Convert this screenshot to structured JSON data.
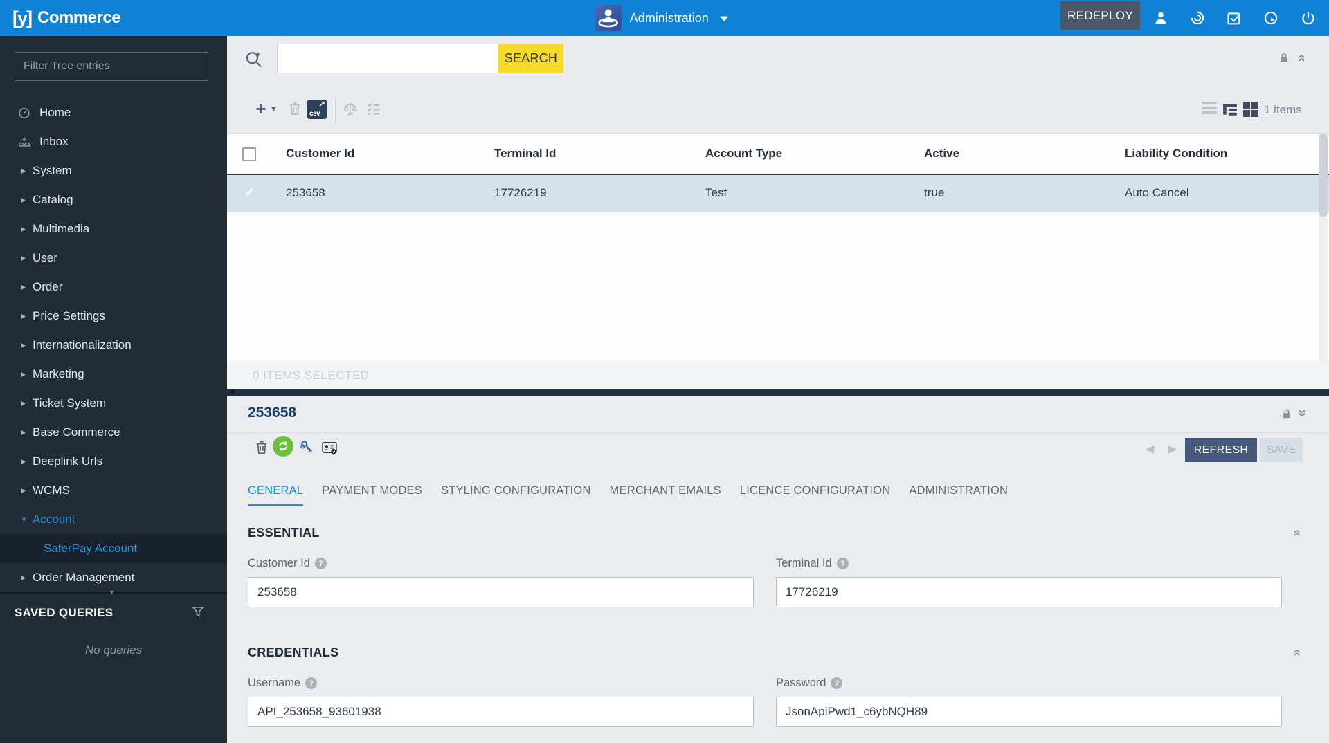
{
  "glyphs": {
    "expand": "▶",
    "collapse": "▼",
    "check": "✓",
    "prev": "◀",
    "next": "▶",
    "chevron_double": "»",
    "plus": "+",
    "caret": "▼",
    "question": "?",
    "arrow_up_right": "↗",
    "csv": "csv",
    "splitter_handle": "◀"
  },
  "colors": {
    "topbar_blue": "#1082d6",
    "accent_blue": "#1793e0",
    "search_yellow": "#f6da2a",
    "sidebar_bg": "#222c37",
    "selected_row_blue": "#d4e2ee",
    "splitter_navy": "#233140",
    "refresh_button": "#44597b"
  },
  "topbar": {
    "logo_mark": "[y]",
    "logo_text": "Commerce",
    "perspective_label": "Administration",
    "redeploy_label": "REDEPLOY"
  },
  "sidebar": {
    "filter_placeholder": "Filter Tree entries",
    "items": [
      {
        "label": "Home"
      },
      {
        "label": "Inbox"
      },
      {
        "label": "System"
      },
      {
        "label": "Catalog"
      },
      {
        "label": "Multimedia"
      },
      {
        "label": "User"
      },
      {
        "label": "Order"
      },
      {
        "label": "Price Settings"
      },
      {
        "label": "Internationalization"
      },
      {
        "label": "Marketing"
      },
      {
        "label": "Ticket System"
      },
      {
        "label": "Base Commerce"
      },
      {
        "label": "Deeplink Urls"
      },
      {
        "label": "WCMS"
      },
      {
        "label": "Account"
      },
      {
        "label": "SaferPay Account"
      },
      {
        "label": "Order Management"
      }
    ],
    "saved_queries_title": "SAVED QUERIES",
    "no_queries_text": "No queries"
  },
  "search": {
    "input_value": "",
    "button_label": "SEARCH"
  },
  "collection": {
    "items_count": "1 items",
    "columns": [
      "Customer Id",
      "Terminal Id",
      "Account Type",
      "Active",
      "Liability Condition"
    ],
    "row": [
      "253658",
      "17726219",
      "Test",
      "true",
      "Auto Cancel"
    ],
    "selected_bar_text": "0 ITEMS SELECTED"
  },
  "editor": {
    "title": "253658",
    "refresh_label": "REFRESH",
    "save_label": "SAVE",
    "tabs": [
      "GENERAL",
      "PAYMENT MODES",
      "STYLING CONFIGURATION",
      "MERCHANT EMAILS",
      "LICENCE CONFIGURATION",
      "ADMINISTRATION"
    ],
    "essential": {
      "title": "ESSENTIAL",
      "fields": [
        {
          "label": "Customer Id",
          "value": "253658"
        },
        {
          "label": "Terminal Id",
          "value": "17726219"
        }
      ]
    },
    "credentials": {
      "title": "CREDENTIALS",
      "fields": [
        {
          "label": "Username",
          "value": "API_253658_93601938"
        },
        {
          "label": "Password",
          "value": "JsonApiPwd1_c6ybNQH89"
        }
      ]
    }
  }
}
